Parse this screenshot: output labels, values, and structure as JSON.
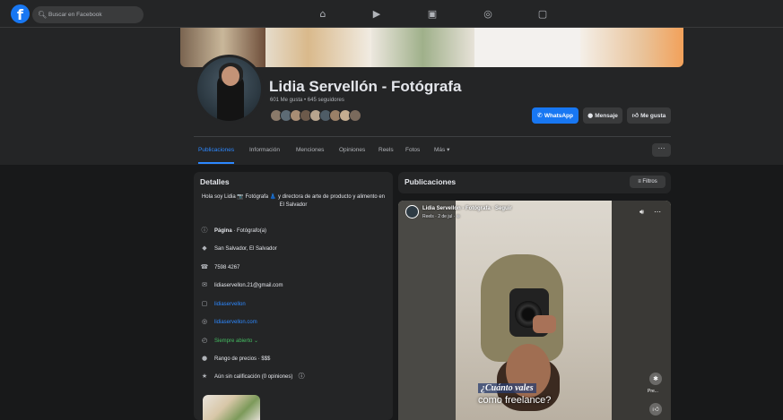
{
  "topbar": {
    "search_placeholder": "Buscar en Facebook",
    "logo": "f",
    "nav_icons": [
      "home-icon",
      "video-icon",
      "marketplace-icon",
      "groups-icon",
      "gaming-icon"
    ]
  },
  "profile": {
    "name": "Lidia Servellón - Fotógrafa",
    "stats": "601 Me gusta • 645 seguidores",
    "buttons": {
      "whatsapp": "WhatsApp",
      "message": "Mensaje",
      "like": "Me gusta"
    },
    "tabs": [
      "Publicaciones",
      "Información",
      "Menciones",
      "Opiniones",
      "Reels",
      "Fotos",
      "Más ▾"
    ],
    "more_label": "···"
  },
  "details": {
    "title": "Detalles",
    "bio": "Hola soy Lidia 📷 Fotógrafa 👗 y directora de arte de producto y alimento en El Salvador",
    "page_bold": "Página",
    "page_type": " · Fotógrafo(a)",
    "location": "San Salvador, El Salvador",
    "phone": "7598 4267",
    "email": "lidiaservellon.21@gmail.com",
    "instagram": "lidiaservellon",
    "website": "lidiaservellon.com",
    "hours": "Siempre abierto ⌄",
    "price": "Rango de precios · $$$",
    "rating": "Aún sin calificación (0 opiniones)"
  },
  "posts": {
    "title": "Publicaciones",
    "filter": "Filtros",
    "reel": {
      "author": "Lidia Servellón - Fotógrafa · Seguir",
      "meta": "Reels · 2 de jul · ⊕",
      "caption_line1": "¿Cuánto vales",
      "caption_line2": "como freelance?",
      "side_label": "Pre..."
    }
  },
  "colors": {
    "accent": "#1877f2",
    "link": "#2d88ff",
    "open_status": "#45bd62",
    "background": "#18191a",
    "card": "#242526"
  }
}
